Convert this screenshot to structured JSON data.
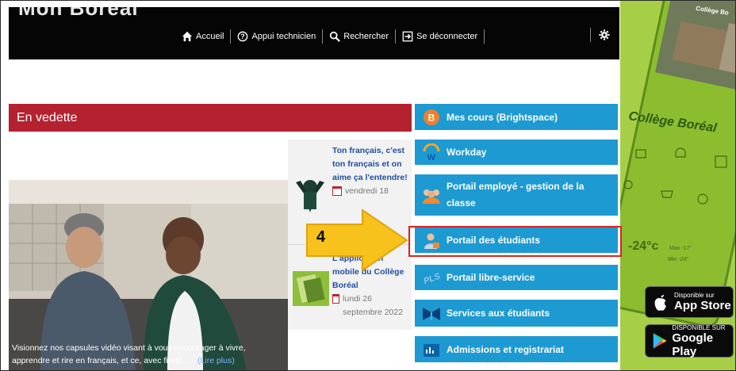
{
  "topbar": {
    "logo_fragment": "Mon Boréal",
    "nav": [
      {
        "label": "Accueil",
        "icon": "home-icon"
      },
      {
        "label": "Appui technicien",
        "icon": "help-circle-icon"
      },
      {
        "label": "Rechercher",
        "icon": "search-icon"
      },
      {
        "label": "Se déconnecter",
        "icon": "logout-icon"
      }
    ],
    "settings_icon": "gear-icon"
  },
  "featured": {
    "header": "En vedette",
    "caption": "Visionnez nos capsules vidéo visant à vous encourager à vivre, apprendre et rire en français, et ce, avec fierté. …",
    "more_link": "(Lire plus)"
  },
  "news": [
    {
      "title": "Ton français, c'est ton français et on aime ça l'entendre!",
      "date": "vendredi 18"
    },
    {
      "title": "L'application mobile du Collège Boréal",
      "date": "lundi 26 septembre 2022"
    }
  ],
  "tiles": [
    {
      "label": "Mes cours (Brightspace)",
      "icon": "brightspace-icon"
    },
    {
      "label": "Workday",
      "icon": "workday-icon"
    },
    {
      "label": "Portail employé - gestion de la classe",
      "icon": "employees-icon"
    },
    {
      "label": "Portail des étudiants",
      "icon": "student-icon"
    },
    {
      "label": "Portail libre-service",
      "icon": "pls-icon"
    },
    {
      "label": "Services aux étudiants",
      "icon": "services-icon"
    },
    {
      "label": "Admissions et registrariat",
      "icon": "admissions-icon"
    }
  ],
  "app_panel": {
    "phone_title": "Collège Boréal",
    "phone_corner": "Collège Bo",
    "temperature": "-24°c",
    "weather_lines": [
      "Max -17°",
      "Min -24°"
    ],
    "apple": {
      "small": "Disponible sur",
      "big": "App Store"
    },
    "google": {
      "small": "DISPONIBLE SUR",
      "big": "Google Play"
    }
  },
  "annotation": {
    "step": "4",
    "color": "#e02020",
    "arrow_color": "#f6c21b"
  },
  "colors": {
    "tile_blue": "#1e9ad2",
    "featured_red": "#b4212f",
    "panel_green": "#a6cf47"
  }
}
